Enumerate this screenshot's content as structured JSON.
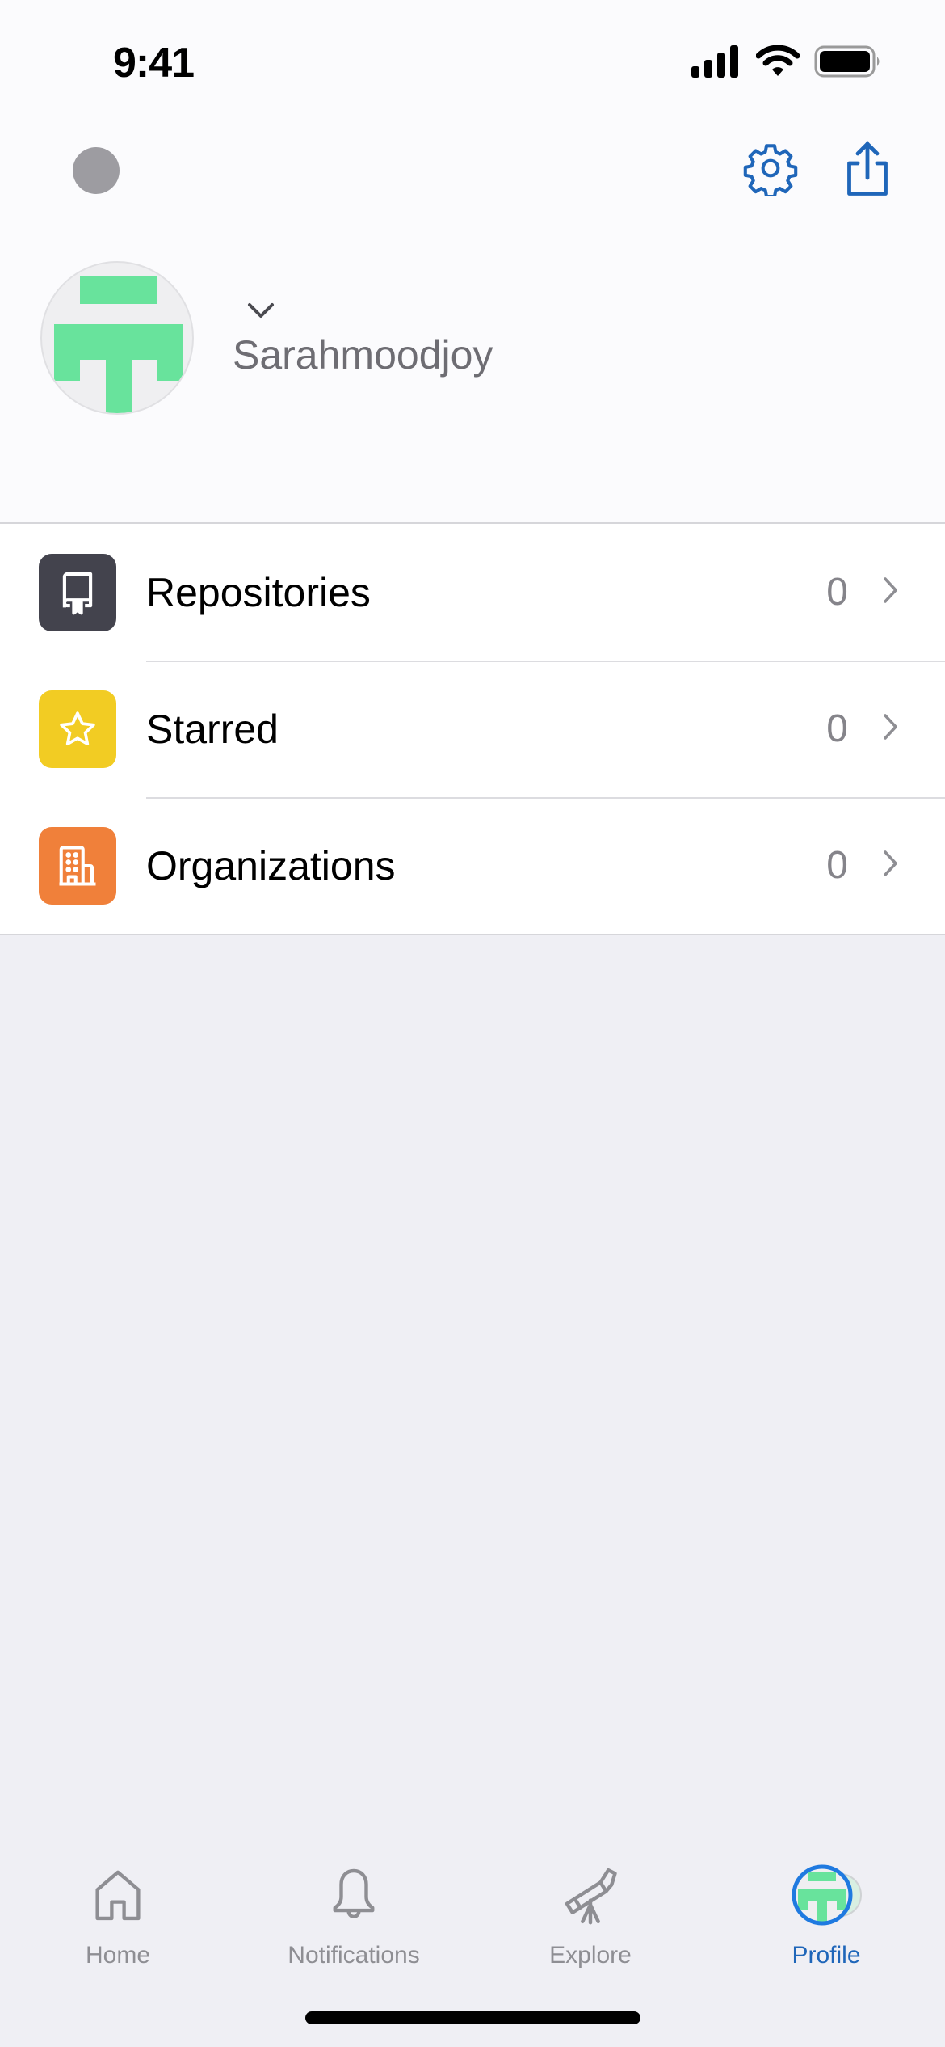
{
  "status_bar": {
    "time": "9:41",
    "icons": [
      "signal-icon",
      "wifi-icon",
      "battery-icon"
    ]
  },
  "header": {
    "left_indicator": "gray-dot",
    "actions": [
      {
        "name": "settings",
        "icon": "gear-icon"
      },
      {
        "name": "share",
        "icon": "share-icon"
      }
    ]
  },
  "profile": {
    "username": "Sarahmoodjoy",
    "account_switcher_icon": "chevron-down-icon",
    "avatar_color": "#68e39c"
  },
  "list": {
    "items": [
      {
        "label": "Repositories",
        "count": "0",
        "icon": "repo-icon",
        "color": "#43434d"
      },
      {
        "label": "Starred",
        "count": "0",
        "icon": "star-icon",
        "color": "#f2cc23"
      },
      {
        "label": "Organizations",
        "count": "0",
        "icon": "organization-icon",
        "color": "#f0803a"
      }
    ]
  },
  "tabbar": {
    "tabs": [
      {
        "label": "Home",
        "icon": "home-icon",
        "active": false
      },
      {
        "label": "Notifications",
        "icon": "bell-icon",
        "active": false
      },
      {
        "label": "Explore",
        "icon": "telescope-icon",
        "active": false
      },
      {
        "label": "Profile",
        "icon": "avatar-icon",
        "active": true
      }
    ],
    "active_color": "#1f66b9",
    "inactive_color": "#8e8e93"
  },
  "colors": {
    "accent": "#1f66b9",
    "background": "#efeff4"
  }
}
